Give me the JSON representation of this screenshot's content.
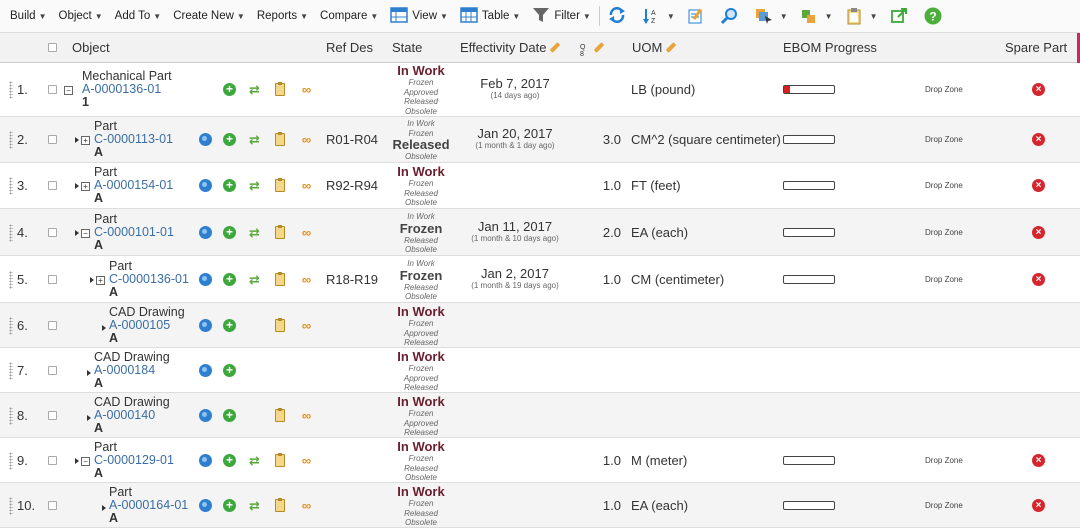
{
  "toolbar": {
    "menus": [
      "Build",
      "Object",
      "Add To",
      "Create New",
      "Reports",
      "Compare"
    ],
    "view_label": "View",
    "table_label": "Table",
    "filter_label": "Filter"
  },
  "columns": {
    "object": "Object",
    "ref_des": "Ref Des",
    "state": "State",
    "effectivity_date": "Effectivity Date",
    "uom": "UOM",
    "ebom_progress": "EBOM Progress",
    "spare_part": "Spare Part"
  },
  "rows": [
    {
      "num": "1.",
      "type": "Mechanical Part",
      "id": "A-0000136-01",
      "rev": "1",
      "level": 0,
      "expander": "minus",
      "ref_des": "",
      "states_before": [],
      "state": "In Work",
      "state_inwork": true,
      "states_after": [
        "Frozen",
        "Approved",
        "Released",
        "Obsolete"
      ],
      "date": "Feb 7, 2017",
      "ago": "(14 days ago)",
      "qty": "",
      "uom": "LB (pound)",
      "progress": 0.12,
      "drop": "Drop Zone",
      "spare": true,
      "icons": [
        "add",
        "sync",
        "clip",
        "link"
      ]
    },
    {
      "num": "2.",
      "type": "Part",
      "id": "C-0000113-01",
      "rev": "A",
      "level": 1,
      "expander": "plus",
      "ref_des": "R01-R04",
      "states_before": [
        "In Work",
        "Frozen"
      ],
      "state": "Released",
      "state_inwork": false,
      "states_after": [
        "Obsolete"
      ],
      "date": "Jan 20, 2017",
      "ago": "(1 month & 1 day ago)",
      "qty": "3.0",
      "uom": "CM^2 (square centimeter)",
      "progress": 0,
      "drop": "Drop Zone",
      "spare": true,
      "icons": [
        "globe",
        "add",
        "sync",
        "clip",
        "link"
      ]
    },
    {
      "num": "3.",
      "type": "Part",
      "id": "A-0000154-01",
      "rev": "A",
      "level": 1,
      "expander": "plus",
      "ref_des": "R92-R94",
      "states_before": [],
      "state": "In Work",
      "state_inwork": true,
      "states_after": [
        "Frozen",
        "Released",
        "Obsolete"
      ],
      "date": "",
      "ago": "",
      "qty": "1.0",
      "uom": "FT (feet)",
      "progress": 0,
      "drop": "Drop Zone",
      "spare": true,
      "icons": [
        "globe",
        "add",
        "sync",
        "clip",
        "link"
      ]
    },
    {
      "num": "4.",
      "type": "Part",
      "id": "C-0000101-01",
      "rev": "A",
      "level": 1,
      "expander": "minus",
      "ref_des": "",
      "states_before": [
        "In Work"
      ],
      "state": "Frozen",
      "state_inwork": false,
      "states_after": [
        "Released",
        "Obsolete"
      ],
      "date": "Jan 11, 2017",
      "ago": "(1 month & 10 days ago)",
      "qty": "2.0",
      "uom": "EA (each)",
      "progress": 0,
      "drop": "Drop Zone",
      "spare": true,
      "icons": [
        "globe",
        "add",
        "sync",
        "clip",
        "link"
      ]
    },
    {
      "num": "5.",
      "type": "Part",
      "id": "C-0000136-01",
      "rev": "A",
      "level": 2,
      "expander": "plus",
      "ref_des": "R18-R19",
      "states_before": [
        "In Work"
      ],
      "state": "Frozen",
      "state_inwork": false,
      "states_after": [
        "Released",
        "Obsolete"
      ],
      "date": "Jan 2, 2017",
      "ago": "(1 month & 19 days ago)",
      "qty": "1.0",
      "uom": "CM (centimeter)",
      "progress": 0,
      "drop": "Drop Zone",
      "spare": true,
      "icons": [
        "globe",
        "add",
        "sync",
        "clip",
        "link"
      ]
    },
    {
      "num": "6.",
      "type": "CAD Drawing",
      "id": "A-0000105",
      "rev": "A",
      "level": 2,
      "expander": "arrow",
      "ref_des": "",
      "states_before": [],
      "state": "In Work",
      "state_inwork": true,
      "states_after": [
        "Frozen",
        "Approved",
        "Released"
      ],
      "date": "",
      "ago": "",
      "qty": "",
      "uom": "",
      "progress": null,
      "drop": "",
      "spare": false,
      "icons": [
        "globe",
        "add",
        "",
        "clip",
        "link"
      ]
    },
    {
      "num": "7.",
      "type": "CAD Drawing",
      "id": "A-0000184",
      "rev": "A",
      "level": 1,
      "expander": "arrow",
      "ref_des": "",
      "states_before": [],
      "state": "In Work",
      "state_inwork": true,
      "states_after": [
        "Frozen",
        "Approved",
        "Released"
      ],
      "date": "",
      "ago": "",
      "qty": "",
      "uom": "",
      "progress": null,
      "drop": "",
      "spare": false,
      "icons": [
        "globe",
        "add",
        "",
        "",
        ""
      ]
    },
    {
      "num": "8.",
      "type": "CAD Drawing",
      "id": "A-0000140",
      "rev": "A",
      "level": 1,
      "expander": "arrow",
      "ref_des": "",
      "states_before": [],
      "state": "In Work",
      "state_inwork": true,
      "states_after": [
        "Frozen",
        "Approved",
        "Released"
      ],
      "date": "",
      "ago": "",
      "qty": "",
      "uom": "",
      "progress": null,
      "drop": "",
      "spare": false,
      "icons": [
        "globe",
        "add",
        "",
        "clip",
        "link"
      ]
    },
    {
      "num": "9.",
      "type": "Part",
      "id": "C-0000129-01",
      "rev": "A",
      "level": 1,
      "expander": "minus",
      "ref_des": "",
      "states_before": [],
      "state": "In Work",
      "state_inwork": true,
      "states_after": [
        "Frozen",
        "Released",
        "Obsolete"
      ],
      "date": "",
      "ago": "",
      "qty": "1.0",
      "uom": "M (meter)",
      "progress": 0,
      "drop": "Drop Zone",
      "spare": true,
      "icons": [
        "globe",
        "add",
        "sync",
        "clip",
        "link"
      ]
    },
    {
      "num": "10.",
      "type": "Part",
      "id": "A-0000164-01",
      "rev": "A",
      "level": 2,
      "expander": "arrow",
      "ref_des": "",
      "states_before": [],
      "state": "In Work",
      "state_inwork": true,
      "states_after": [
        "Frozen",
        "Released",
        "Obsolete"
      ],
      "date": "",
      "ago": "",
      "qty": "1.0",
      "uom": "EA (each)",
      "progress": 0,
      "drop": "Drop Zone",
      "spare": true,
      "icons": [
        "globe",
        "add",
        "sync",
        "clip",
        "link"
      ]
    }
  ],
  "colors": {
    "link": "#3a6ea5",
    "in_work": "#6b1f2e",
    "delete": "#d6262d",
    "progress_fill": "#d92020"
  }
}
